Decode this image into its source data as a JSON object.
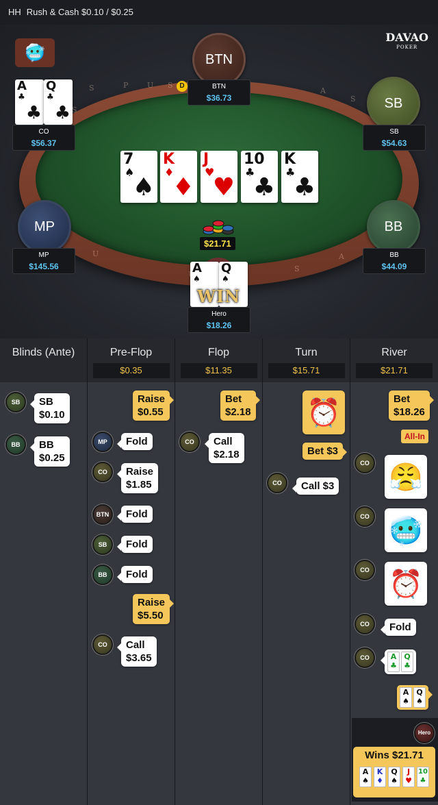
{
  "header": {
    "tag": "HH",
    "title": "Rush & Cash $0.10 / $0.25"
  },
  "logo": {
    "brand": "DAVAO",
    "sub": "POKER"
  },
  "rail_letters": [
    "U",
    "S",
    "P",
    "U",
    "S",
    "A",
    "S",
    "U",
    "S",
    "A",
    "U",
    "S"
  ],
  "seats": {
    "btn": {
      "avatar": "BTN",
      "name": "BTN",
      "stack": "$36.73"
    },
    "sb": {
      "avatar": "SB",
      "name": "SB",
      "stack": "$54.63"
    },
    "co": {
      "name": "CO",
      "stack": "$56.37"
    },
    "mp": {
      "avatar": "MP",
      "name": "MP",
      "stack": "$145.56"
    },
    "bb": {
      "avatar": "BB",
      "name": "BB",
      "stack": "$44.09"
    },
    "hero": {
      "name": "Hero",
      "stack": "$18.26",
      "win_label": "WIN"
    }
  },
  "co_cards": [
    {
      "rank": "A",
      "suit": "♣"
    },
    {
      "rank": "Q",
      "suit": "♣"
    }
  ],
  "hero_cards": [
    {
      "rank": "A",
      "suit": "♠"
    },
    {
      "rank": "Q",
      "suit": "♠"
    }
  ],
  "board": [
    {
      "rank": "7",
      "suit": "♠",
      "color": "black"
    },
    {
      "rank": "K",
      "suit": "♦",
      "color": "red"
    },
    {
      "rank": "J",
      "suit": "♥",
      "color": "red"
    },
    {
      "rank": "10",
      "suit": "♣",
      "color": "black"
    },
    {
      "rank": "K",
      "suit": "♣",
      "color": "black"
    }
  ],
  "pot": "$21.71",
  "dealer_label": "D",
  "streets": [
    {
      "name": "Blinds (Ante)",
      "pot": ""
    },
    {
      "name": "Pre-Flop",
      "pot": "$0.35"
    },
    {
      "name": "Flop",
      "pot": "$11.35"
    },
    {
      "name": "Turn",
      "pot": "$15.71"
    },
    {
      "name": "River",
      "pot": "$21.71"
    }
  ],
  "blinds": [
    {
      "pos": "SB",
      "line1": "SB",
      "line2": "$0.10"
    },
    {
      "pos": "BB",
      "line1": "BB",
      "line2": "$0.25"
    }
  ],
  "preflop": [
    {
      "line1": "Raise",
      "line2": "$0.55"
    },
    {
      "pos": "MP",
      "line1": "Fold"
    },
    {
      "pos": "CO",
      "line1": "Raise",
      "line2": "$1.85"
    },
    {
      "pos": "BTN",
      "line1": "Fold"
    },
    {
      "pos": "SB",
      "line1": "Fold"
    },
    {
      "pos": "BB",
      "line1": "Fold"
    },
    {
      "line1": "Raise",
      "line2": "$5.50"
    },
    {
      "pos": "CO",
      "line1": "Call",
      "line2": "$3.65"
    }
  ],
  "flop": [
    {
      "line1": "Bet",
      "line2": "$2.18"
    },
    {
      "pos": "CO",
      "line1": "Call",
      "line2": "$2.18"
    }
  ],
  "turn": [
    {
      "emote": "alarm-clock"
    },
    {
      "line1": "Bet  $3"
    },
    {
      "pos": "CO",
      "line1": "Call  $3"
    }
  ],
  "river": {
    "bet": {
      "line1": "Bet",
      "line2": "$18.26"
    },
    "allin": "All-In",
    "co_pos": "CO",
    "co_emotes": [
      "angry-face",
      "frozen-face",
      "alarm-clock"
    ],
    "fold": "Fold",
    "co_show": [
      {
        "rank": "A",
        "suit": "♣"
      },
      {
        "rank": "Q",
        "suit": "♣"
      }
    ],
    "hero_show": [
      {
        "rank": "A",
        "suit": "♠"
      },
      {
        "rank": "Q",
        "suit": "♠"
      }
    ],
    "hero_pos": "Hero",
    "wins": "Wins $21.71",
    "win_cards": [
      {
        "rank": "A",
        "suit": "♠"
      },
      {
        "rank": "K",
        "suit": "♦"
      },
      {
        "rank": "Q",
        "suit": "♠"
      },
      {
        "rank": "J",
        "suit": "♥"
      },
      {
        "rank": "10",
        "suit": "♣"
      }
    ]
  },
  "colors": {
    "accent_yellow": "#f5c65a",
    "stack_blue": "#5fc3f0",
    "pot_yellow": "#ffe14a",
    "felt": "#1f5229",
    "rail": "#7a3f2c"
  }
}
